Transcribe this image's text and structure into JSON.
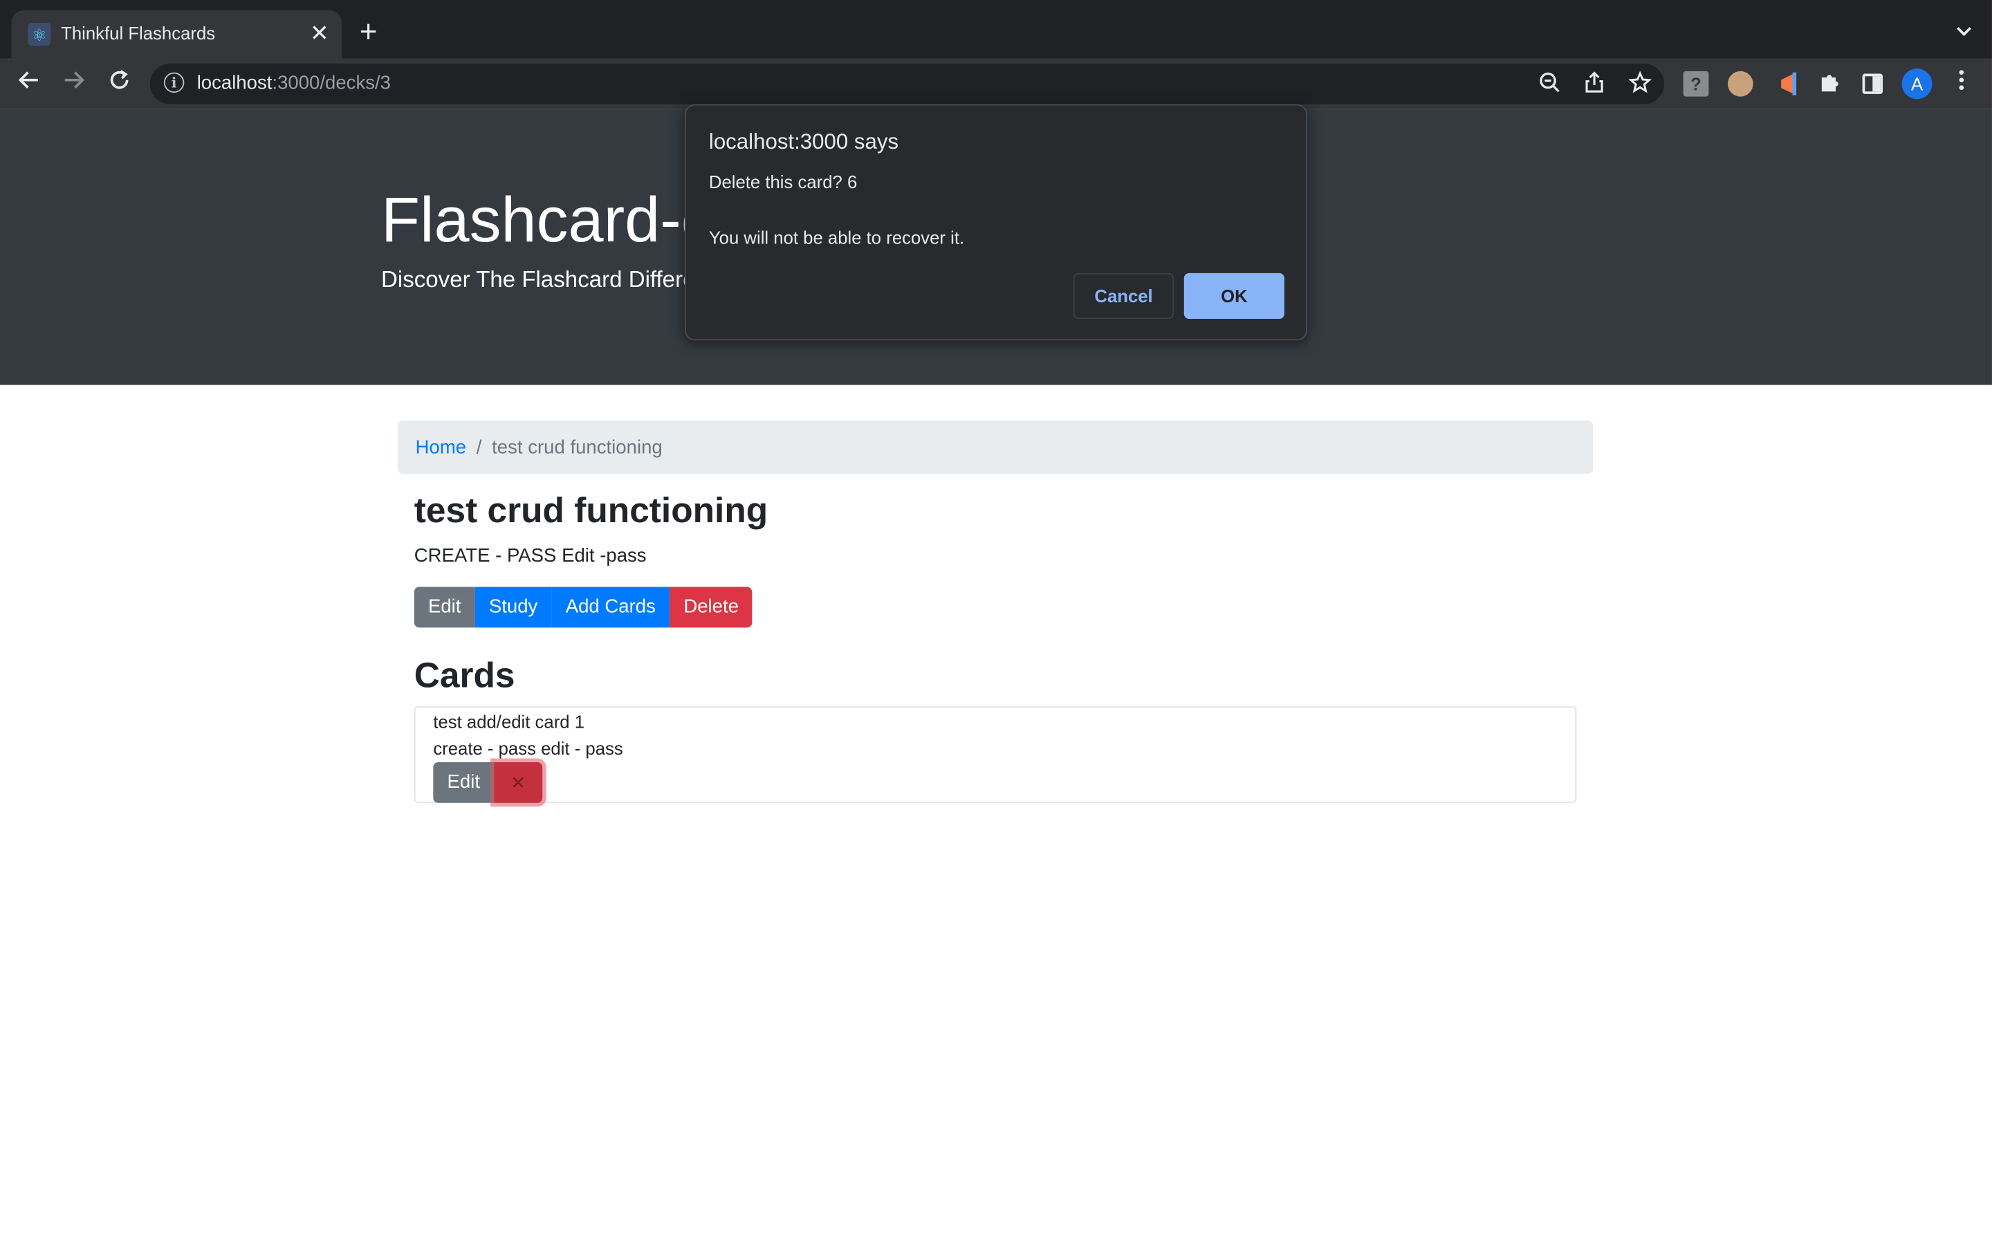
{
  "browser": {
    "tab_title": "Thinkful Flashcards",
    "tab_close": "✕",
    "new_tab": "+",
    "tab_menu": "⌄",
    "url_host": "localhost",
    "url_path": ":3000/decks/3",
    "avatar_letter": "A",
    "icons": [
      "back-icon",
      "forward-icon",
      "reload-icon",
      "info-icon",
      "zoom-icon",
      "share-icon",
      "star-icon",
      "extension-help-icon",
      "extension-owl-icon",
      "extension-flag-icon",
      "extensions-puzzle-icon",
      "side-panel-icon",
      "kebab-menu-icon"
    ]
  },
  "header": {
    "title": "Flashcard-o",
    "lead": "Discover The Flashcard Differen"
  },
  "breadcrumb": {
    "home": "Home",
    "separator": "/",
    "current": "test crud functioning"
  },
  "deck": {
    "name": "test crud functioning",
    "description": "CREATE - PASS Edit -pass",
    "buttons": {
      "edit": "Edit",
      "study": "Study",
      "add_cards": "Add Cards",
      "delete": "Delete"
    }
  },
  "cards_section": {
    "heading": "Cards",
    "cards": [
      {
        "front": "test add/edit card 1",
        "back": "create - pass edit - pass",
        "edit_label": "Edit",
        "delete_label": "✕"
      }
    ]
  },
  "dialog": {
    "title": "localhost:3000 says",
    "message_line1": "Delete this card? 6",
    "message_line2": "You will not be able to recover it.",
    "cancel": "Cancel",
    "ok": "OK"
  },
  "colors": {
    "chrome_dark": "#202124",
    "chrome_toolbar": "#35363a",
    "jumbotron": "#343a40",
    "primary": "#007bff",
    "secondary": "#6c757d",
    "danger": "#dc3545",
    "dialog_bg": "#292a2d",
    "dialog_accent": "#8ab4f8"
  }
}
